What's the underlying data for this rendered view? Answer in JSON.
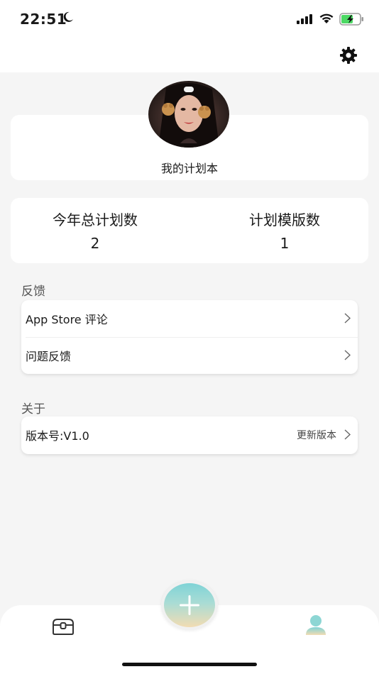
{
  "status_bar": {
    "time": "22:51"
  },
  "profile": {
    "plan_name": "我的计划本"
  },
  "stats": {
    "annual_plans_label": "今年总计划数",
    "annual_plans_value": "2",
    "templates_label": "计划模版数",
    "templates_value": "1"
  },
  "feedback": {
    "title": "反馈",
    "items": [
      {
        "label": "App Store 评论"
      },
      {
        "label": "问题反馈"
      }
    ]
  },
  "about": {
    "title": "关于",
    "version_label": "版本号:V1.0",
    "update_label": "更新版本"
  },
  "colors": {
    "accent_gradient_top": "#7fd3d6",
    "accent_gradient_bottom": "#f2dcb3"
  },
  "icons": [
    "moon-icon",
    "signal-icon",
    "wifi-icon",
    "battery-icon",
    "gear-icon",
    "chevron-right-icon",
    "plus-icon",
    "treasure-box-icon",
    "user-icon"
  ]
}
